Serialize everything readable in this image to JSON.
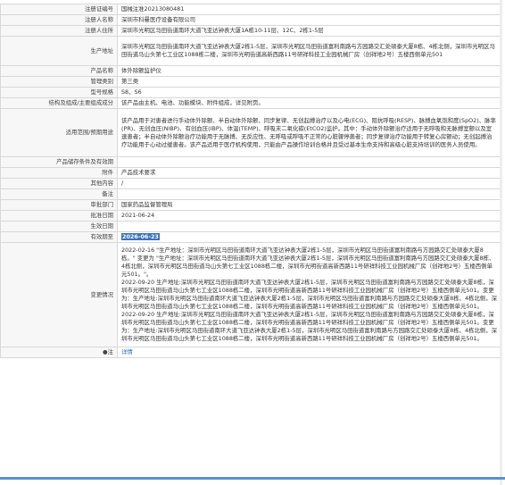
{
  "rows": [
    {
      "key": "reg_no",
      "label": "注册证编号",
      "value": "国械注准20213080481"
    },
    {
      "key": "registrant",
      "label": "注册人名称",
      "value": "深圳市科曼医疗设备有限公司"
    },
    {
      "key": "registrant_address",
      "label": "注册人住所",
      "value": "深圳市光明区马田街道南环大道飞亚达钟表大厦1A栋10-11层、12C、2栋1-5层"
    },
    {
      "key": "production_address",
      "label": "生产地址",
      "value": "深圳市光明区马田街道南环大道飞亚达钟表大厦2栋1-5层，深圳市光明区马田街道富利南路与方园路交汇处硕泰大厦8栋、4栋北侧，深圳市光明区马田街道马山头第七工业区1088栋二楼，深圳市光明街道高新西路11号研祥科技工业园机械厂房（创祥地2号）五楼西侧单元501"
    },
    {
      "key": "product_name",
      "label": "产品名称",
      "value": "体外除颤监护仪"
    },
    {
      "key": "mgmt_class",
      "label": "管理类别",
      "value": "第三类"
    },
    {
      "key": "model_spec",
      "label": "型号规格",
      "value": "S8、S6"
    },
    {
      "key": "structure",
      "label": "结构及组成/主要组成成分",
      "value": "该产品由主机、电池、功能模块、附件组成，详见附页。"
    },
    {
      "key": "intended_use",
      "label": "适用范围/预期用途",
      "value": "该产品用于对患者进行手动体外除颤、半自动体外除颤、同步复律、无创起搏治疗以及心电(ECG)、阻抗呼吸(RESP)、脉搏血氧饱和度(SpO2)、脉率(PR)、无创血压(NIBP)、有创血压(IBP)、体温(TEMP)、呼吸末二氧化碳(EtCO2)监护。其中：手动体外除颤治疗适用于无呼吸和无脉搏室颤以及室速患者；半自动体外除颤治疗功能用于无脉搏、无反应性、无呼吸或呼吸不正常的心脏骤停患者；同步复律治疗功能用于转复心房颤动；无创起搏治疗功能用于心动过缓患者。该产品适用于医疗机构使用，只能由产品操作培训合格并且受过基本生命支持和高级心脏支持培训的医务人员使用。"
    },
    {
      "key": "storage",
      "label": "产品储存条件及有效期",
      "value": ""
    },
    {
      "key": "attachment",
      "label": "附件",
      "value": "产品技术要求"
    },
    {
      "key": "other",
      "label": "其他内容",
      "value": "/"
    },
    {
      "key": "remarks",
      "label": "备注",
      "value": ""
    },
    {
      "key": "approval_dept",
      "label": "审批部门",
      "value": "国家药品监督管理局"
    },
    {
      "key": "approval_date",
      "label": "批准日期",
      "value": "2021-06-24"
    },
    {
      "key": "effective_date",
      "label": "生效日期",
      "value": ""
    },
    {
      "key": "valid_until",
      "label": "有效期至",
      "value": "2026-06-23"
    }
  ],
  "changes_label": "变更情况",
  "changes": [
    "2022-02-16 \"生产地址：深圳市光明区马田街道南环大道飞亚达钟表大厦2栋1-5层，深圳市光明区马田街道富利南路与方园路交汇处硕泰大厦8栋。\" 变更为 \"生产地址：深圳市光明区马田街道南环大道飞亚达钟表大厦2栋1-5层，深圳市光明区马田街道富利南路与方园路交汇处硕泰大厦8栋、4栋北侧，深圳市光明区马田街道马山头第七工业区1088栋二楼，深圳市光明街道高新西路11号研祥科技工业园机械厂房（创祥地2号）五楼西侧单元501。\"。",
    "2022-09-20 生产地址:深圳市光明区马田街道南环大道飞亚达钟表大厦2栋1-5层，深圳市光明区马田街道富利南路与方园路交汇处硕泰大厦8栋，深圳市光明区马田街道马山头第七工业区1088栋二楼，深圳市光明街道高新西路11号研祥科技工业园机械厂房（创祥地2号）五楼西侧单元501。变更为：生产地址:深圳市光明区马田街道南环大道飞亚达钟表大厦2栋1-5层，深圳市光明区马田街道富利南路与方园路交汇处硕泰大厦8栋、4栋北侧，深圳市光明区马田街道马山头第七工业区1088栋二楼，深圳市光明街道高新西路11号研祥科技工业园机械厂房（创祥地2号）五楼西侧单元501。",
    "2022-09-20 生产地址:深圳市光明区马田街道南环大道飞亚达钟表大厦2栋1-5层，深圳市光明区马田街道富利南路与方园路交汇处硕泰大厦8栋，深圳市光明区马田街道马山头第七工业区1088栋二楼，深圳市光明街道高新西路11号研祥科技工业园机械厂房（创祥地2号）五楼西侧单元501。变更为：生产地址:深圳市光明区马田街道南环大道飞亚达钟表大厦2栋1-5层，深圳市光明区马田街道富利南路与方园路交汇处硕泰大厦8栋、4栋北侧，深圳市光明区马田街道马山头第七工业区1088栋二楼，深圳市光明街道高新西路11号研祥科技工业园机械厂房（创祥地2号）五楼西侧单元501。"
  ],
  "note_label": "●注",
  "note_link": "详情"
}
